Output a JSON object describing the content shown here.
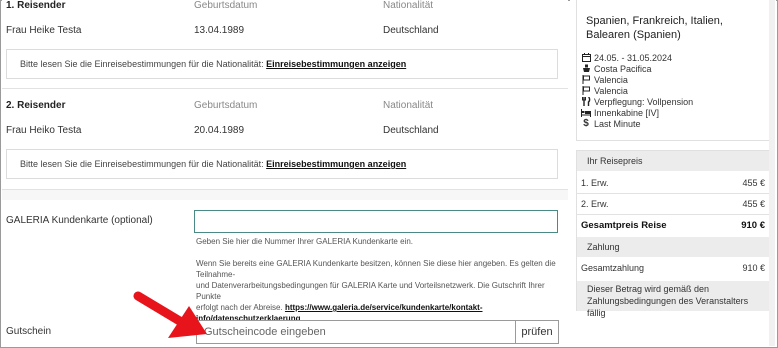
{
  "passengers": [
    {
      "heading": "1. Reisender",
      "dob_label": "Geburtsdatum",
      "nationality_label": "Nationalität",
      "name": "Frau Heike Testa",
      "dob": "13.04.1989",
      "nationality": "Deutschland",
      "info_text": "Bitte lesen Sie die Einreisebestimmungen für die Nationalität:",
      "info_link": "Einreisebestimmungen anzeigen"
    },
    {
      "heading": "2. Reisender",
      "dob_label": "Geburtsdatum",
      "nationality_label": "Nationalität",
      "name": "Frau Heiko Testa",
      "dob": "20.04.1989",
      "nationality": "Deutschland",
      "info_text": "Bitte lesen Sie die Einreisebestimmungen für die Nationalität:",
      "info_link": "Einreisebestimmungen anzeigen"
    }
  ],
  "kundenkarte": {
    "label": "GALERIA Kundenkarte (optional)",
    "value": "",
    "hint": "Geben Sie hier die Nummer Ihrer GALERIA Kundenkarte ein.",
    "note_line1": "Wenn Sie bereits eine GALERIA Kundenkarte besitzen, können Sie diese hier angeben. Es gelten die Teilnahme-",
    "note_line2": "und Datenverarbeitungsbedingungen für GALERIA Karte und Vorteilsnetzwerk. Die Gutschrift Ihrer Punkte",
    "note_line3": "erfolgt nach der Abreise.",
    "note_link1": "https://www.galeria.de/service/kundenkarte/kontakt-",
    "note_link2": "info/datenschutzerklaerung"
  },
  "gutschein": {
    "label": "Gutschein",
    "placeholder": "Gutscheincode eingeben",
    "button": "prüfen"
  },
  "trip": {
    "title": "Spanien, Frankreich, Italien, Balearen (Spanien)",
    "items": [
      {
        "icon": "calendar-icon",
        "text": "24.05. - 31.05.2024"
      },
      {
        "icon": "ship-icon",
        "text": "Costa Pacifica"
      },
      {
        "icon": "flag-icon",
        "text": "Valencia"
      },
      {
        "icon": "flag-icon",
        "text": "Valencia"
      },
      {
        "icon": "cutlery-icon",
        "text": "Verpflegung: Vollpension"
      },
      {
        "icon": "bed-icon",
        "text": "Innenkabine [IV]"
      },
      {
        "icon": "dollar-icon",
        "text": "Last Minute"
      }
    ]
  },
  "price": {
    "header": "Ihr Reisepreis",
    "rows": [
      {
        "label": "1. Erw.",
        "value": "455 €"
      },
      {
        "label": "2. Erw.",
        "value": "455 €"
      }
    ],
    "total_label": "Gesamtpreis Reise",
    "total_value": "910 €",
    "payment_header": "Zahlung",
    "payment_label": "Gesamtzahlung",
    "payment_value": "910 €",
    "note": "Dieser Betrag wird gemäß den Zahlungsbedingungen des Veranstalters fällig"
  },
  "colors": {
    "arrow": "#e8141b",
    "input_border": "#4a8a86"
  }
}
